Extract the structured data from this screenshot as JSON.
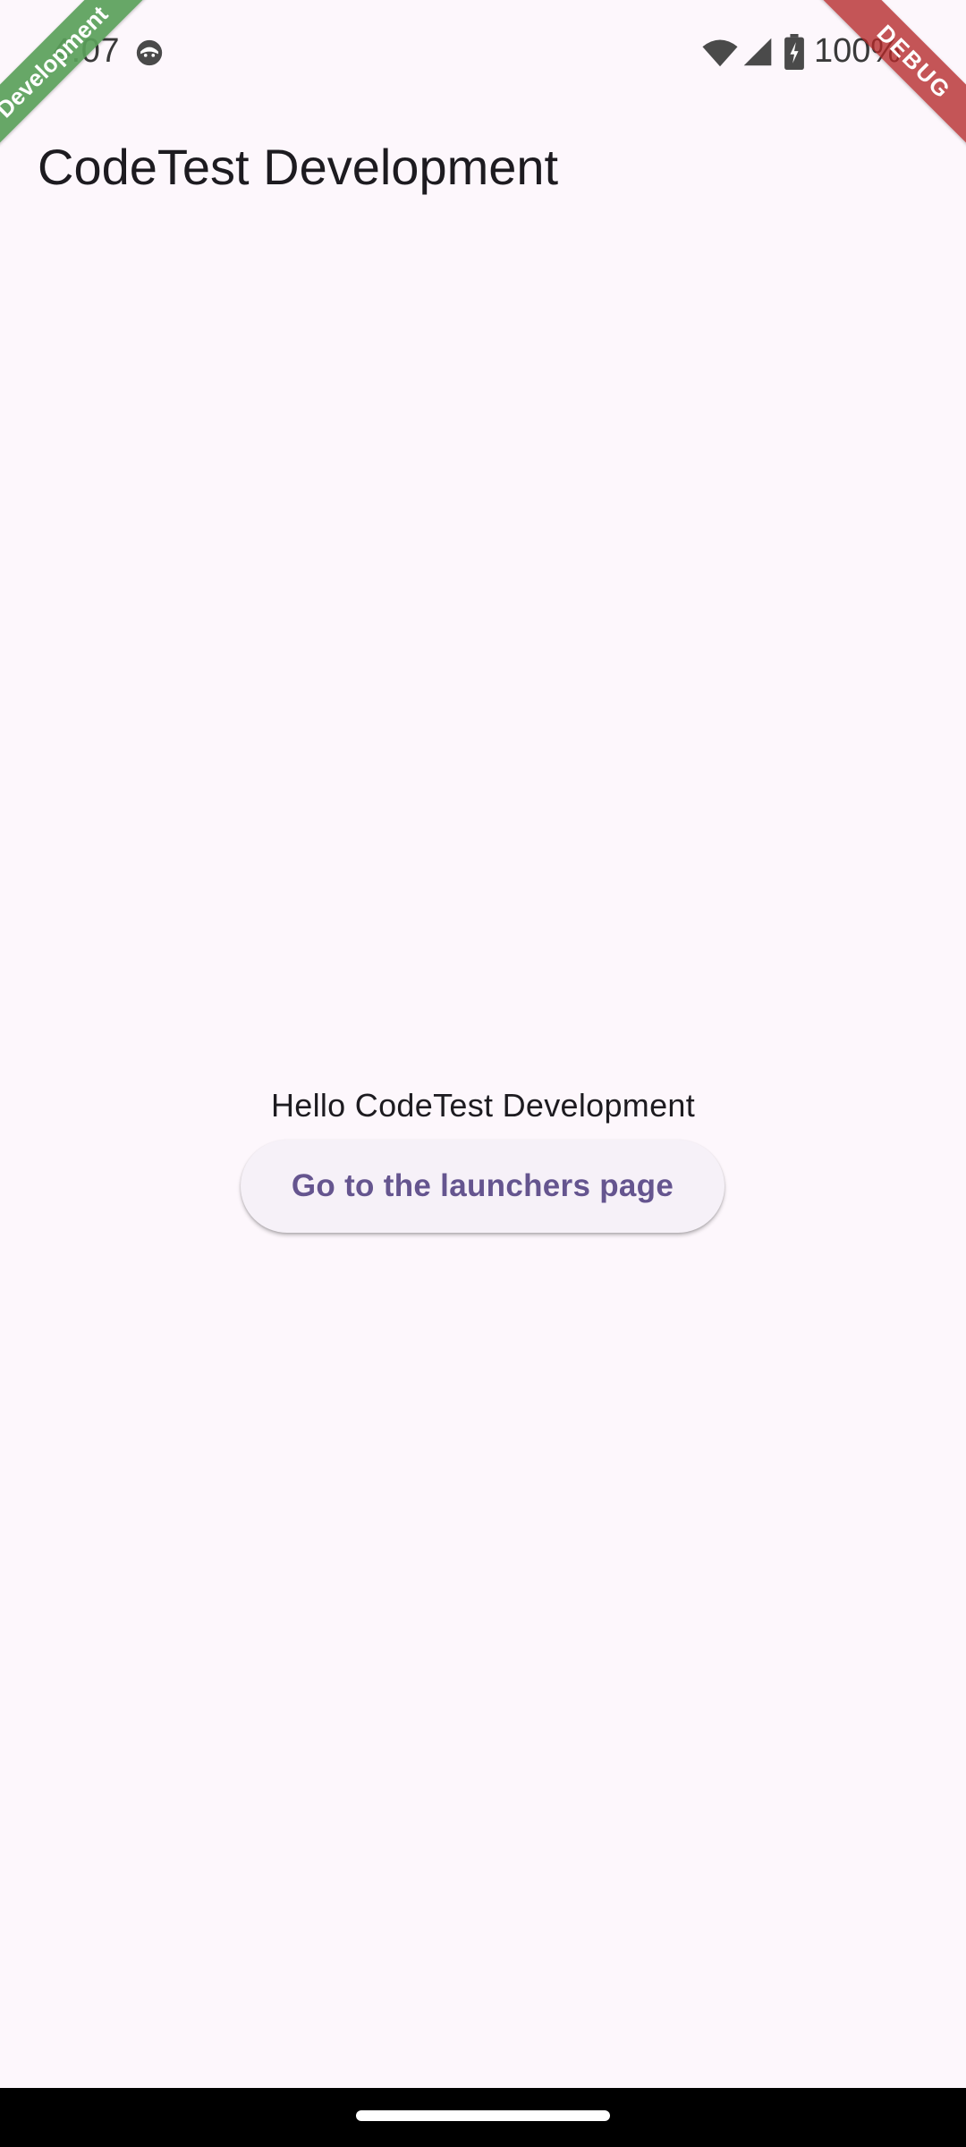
{
  "status_bar": {
    "time": "4:07",
    "battery_percent": "100%",
    "icons": [
      "face-notification-icon",
      "wifi-icon",
      "cell-signal-icon",
      "battery-charging-icon"
    ]
  },
  "app_bar": {
    "title": "CodeTest Development"
  },
  "main": {
    "greeting": "Hello CodeTest Development",
    "launch_button_label": "Go to the launchers page"
  },
  "banners": {
    "flavor_label": "Development",
    "debug_label": "DEBUG"
  },
  "colors": {
    "background": "#fdf7fc",
    "primary_text": "#1d1b20",
    "button_text": "#65558f",
    "button_bg": "#f6f1f8",
    "flavor_banner": "#5aa05a",
    "debug_banner": "#b42828",
    "nav_bar": "#000000"
  }
}
